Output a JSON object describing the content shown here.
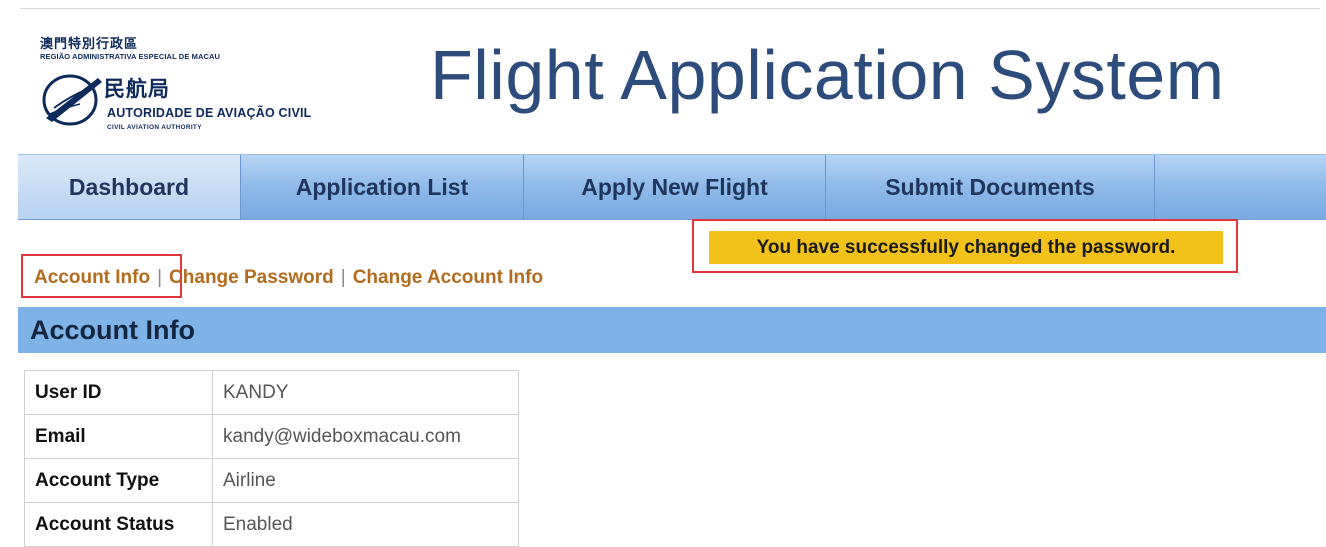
{
  "logo": {
    "cn_region": "澳門特別行政區",
    "pt_region": "REGIÃO ADMINISTRATIVA ESPECIAL DE MACAU",
    "cn_authority": "民航局",
    "pt_authority": "AUTORIDADE DE AVIAÇÃO CIVIL",
    "en_authority": "CIVIL AVIATION AUTHORITY",
    "emblem_icon": "aviation-emblem-icon"
  },
  "app_title": "Flight Application System",
  "nav": {
    "tabs": [
      {
        "label": "Dashboard",
        "active": true
      },
      {
        "label": "Application List",
        "active": false
      },
      {
        "label": "Apply New Flight",
        "active": false
      },
      {
        "label": "Submit Documents",
        "active": false
      }
    ]
  },
  "notice": {
    "message": "You have successfully changed the password.",
    "color": "#f2c21a"
  },
  "subnav": {
    "items": [
      "Account Info",
      "Change Password",
      "Change Account Info"
    ],
    "separator": "|"
  },
  "section": {
    "title": "Account Info"
  },
  "account": {
    "rows": [
      {
        "label": "User ID",
        "value": "KANDY"
      },
      {
        "label": "Email",
        "value": "kandy@wideboxmacau.com"
      },
      {
        "label": "Account Type",
        "value": "Airline"
      },
      {
        "label": "Account Status",
        "value": "Enabled"
      }
    ]
  },
  "colors": {
    "title": "#2c4c7c",
    "nav": "#8fb9e8",
    "link": "#b36b1e",
    "section_header": "#7fb2e6",
    "highlight_frame": "#e0333a"
  }
}
